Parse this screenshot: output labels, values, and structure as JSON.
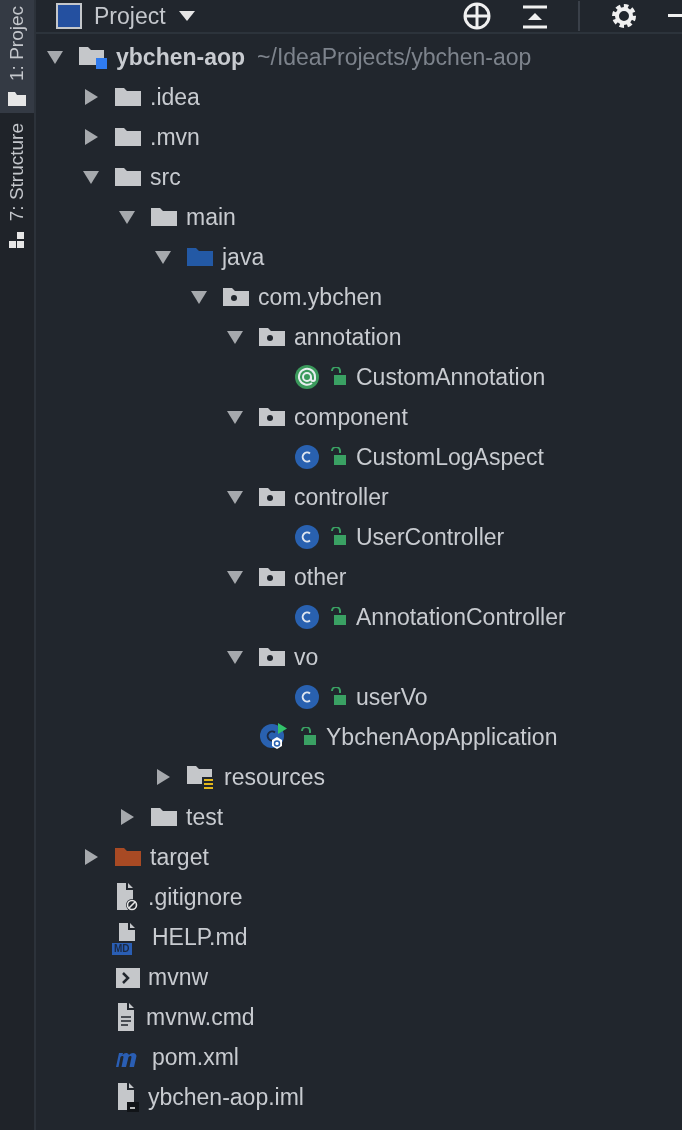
{
  "sidebar": {
    "tabs": [
      {
        "label": "1: Projec",
        "selected": true
      },
      {
        "label": "7: Structure",
        "selected": false
      }
    ]
  },
  "header": {
    "title": "Project"
  },
  "tree": [
    {
      "name": "ybchen-aop",
      "path": "~/IdeaProjects/ybchen-aop",
      "kind": "module",
      "expanded": true,
      "children": [
        {
          "name": ".idea",
          "kind": "folder",
          "expanded": false
        },
        {
          "name": ".mvn",
          "kind": "folder",
          "expanded": false
        },
        {
          "name": "src",
          "kind": "folder",
          "expanded": true,
          "children": [
            {
              "name": "main",
              "kind": "folder",
              "expanded": true,
              "children": [
                {
                  "name": "java",
                  "kind": "source",
                  "expanded": true,
                  "children": [
                    {
                      "name": "com.ybchen",
                      "kind": "package",
                      "expanded": true,
                      "children": [
                        {
                          "name": "annotation",
                          "kind": "package",
                          "expanded": true,
                          "children": [
                            {
                              "name": "CustomAnnotation",
                              "kind": "annotation"
                            }
                          ]
                        },
                        {
                          "name": "component",
                          "kind": "package",
                          "expanded": true,
                          "children": [
                            {
                              "name": "CustomLogAspect",
                              "kind": "class"
                            }
                          ]
                        },
                        {
                          "name": "controller",
                          "kind": "package",
                          "expanded": true,
                          "children": [
                            {
                              "name": "UserController",
                              "kind": "class"
                            }
                          ]
                        },
                        {
                          "name": "other",
                          "kind": "package",
                          "expanded": true,
                          "children": [
                            {
                              "name": "AnnotationController",
                              "kind": "class"
                            }
                          ]
                        },
                        {
                          "name": "vo",
                          "kind": "package",
                          "expanded": true,
                          "children": [
                            {
                              "name": "userVo",
                              "kind": "class"
                            }
                          ]
                        },
                        {
                          "name": "YbchenAopApplication",
                          "kind": "app"
                        }
                      ]
                    }
                  ]
                },
                {
                  "name": "resources",
                  "kind": "resources",
                  "expanded": false
                }
              ]
            },
            {
              "name": "test",
              "kind": "folder",
              "expanded": false
            }
          ]
        },
        {
          "name": "target",
          "kind": "excluded",
          "expanded": false
        },
        {
          "name": ".gitignore",
          "kind": "ignore"
        },
        {
          "name": "HELP.md",
          "kind": "markdown",
          "badge": "MD"
        },
        {
          "name": "mvnw",
          "kind": "shell"
        },
        {
          "name": "mvnw.cmd",
          "kind": "text"
        },
        {
          "name": "pom.xml",
          "kind": "maven"
        },
        {
          "name": "ybchen-aop.iml",
          "kind": "iml"
        }
      ]
    }
  ]
}
